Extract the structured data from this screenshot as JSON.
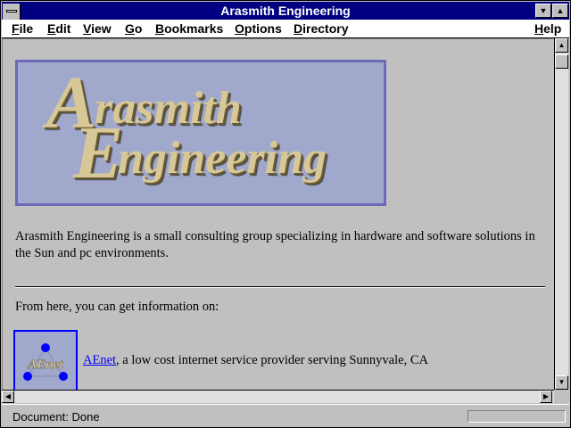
{
  "window": {
    "title": "Arasmith Engineering"
  },
  "menubar": {
    "items": [
      {
        "label": "File",
        "hotkey": "F",
        "rest": "ile"
      },
      {
        "label": "Edit",
        "hotkey": "E",
        "rest": "dit"
      },
      {
        "label": "View",
        "hotkey": "V",
        "rest": "iew"
      },
      {
        "label": "Go",
        "hotkey": "G",
        "rest": "o"
      },
      {
        "label": "Bookmarks",
        "hotkey": "B",
        "rest": "ookmarks"
      },
      {
        "label": "Options",
        "hotkey": "O",
        "rest": "ptions"
      },
      {
        "label": "Directory",
        "hotkey": "D",
        "rest": "irectory"
      },
      {
        "label": "Help",
        "hotkey": "H",
        "rest": "elp"
      }
    ]
  },
  "content": {
    "logo": {
      "line1_initial": "A",
      "line1_rest": "rasmith",
      "line2_initial": "E",
      "line2_rest": "ngineering"
    },
    "intro": "Arasmith Engineering is a small consulting group specializing in hardware and software solutions in the Sun and pc environments.",
    "from_here": "From here, you can get information on:",
    "aenet_icon_label": "AEnet",
    "aenet_link": "AEnet",
    "aenet_desc": ", a low cost internet service provider serving Sunnyvale, CA"
  },
  "status": {
    "text": "Document: Done"
  },
  "colors": {
    "titlebar": "#000080",
    "link": "#0000ff",
    "logo_bg": "#a0a8cc",
    "logo_text": "#d8c898"
  },
  "icons": {
    "system_menu": "system-menu-icon",
    "minimize": "minimize-icon",
    "maximize": "maximize-icon"
  }
}
